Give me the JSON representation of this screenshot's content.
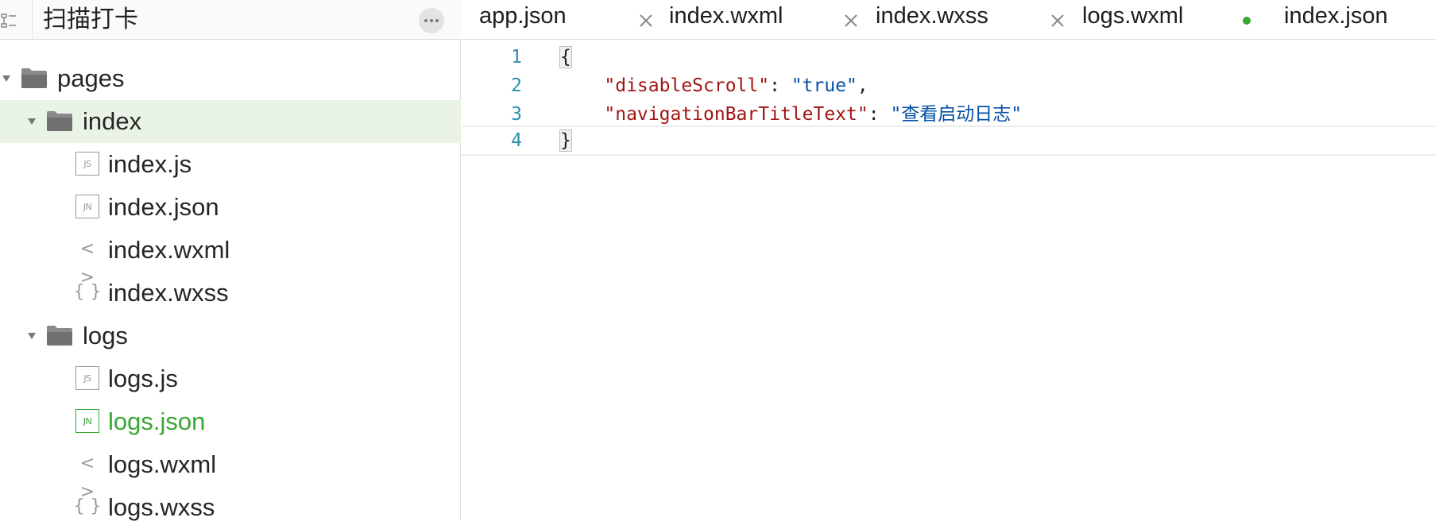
{
  "sidebar": {
    "title": "扫描打卡",
    "tree": {
      "pages": "pages",
      "index": "index",
      "index_files": [
        "index.js",
        "index.json",
        "index.wxml",
        "index.wxss"
      ],
      "logs": "logs",
      "logs_files": [
        "logs.js",
        "logs.json",
        "logs.wxml",
        "logs.wxss"
      ],
      "icons": {
        "js": "JS",
        "json": "JN",
        "wxml": "< >",
        "wxss": "{ }"
      }
    },
    "selected_folder": "index",
    "active_file": "logs.json"
  },
  "tabs": [
    {
      "label": "app.json"
    },
    {
      "label": "index.wxml"
    },
    {
      "label": "index.wxss"
    },
    {
      "label": "logs.wxml"
    },
    {
      "label": "index.json"
    }
  ],
  "editor": {
    "line_numbers": [
      "1",
      "2",
      "3",
      "4"
    ],
    "lines": {
      "open": "{",
      "l2_key": "\"disableScroll\"",
      "l2_sep": ": ",
      "l2_val": "\"true\"",
      "l2_end": ",",
      "l3_key": "\"navigationBarTitleText\"",
      "l3_sep": ": ",
      "l3_val": "\"查看启动日志\"",
      "close": "}"
    }
  },
  "colors": {
    "accent": "#3aa635",
    "key": "#a31515",
    "string": "#0451a5",
    "line_number": "#2b8fb0",
    "selected_row": "#e9f3e6"
  }
}
